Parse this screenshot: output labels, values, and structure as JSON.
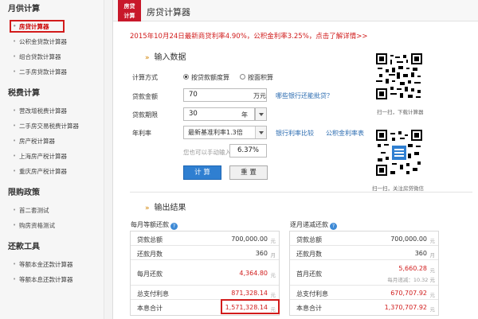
{
  "sidebar": {
    "sections": [
      {
        "title": "月供计算",
        "items": [
          "房贷计算器",
          "公积金贷款计算器",
          "组合贷款计算器",
          "二手房贷款计算器"
        ]
      },
      {
        "title": "税费计算",
        "items": [
          "营改增税费计算器",
          "二手房交易税费计算器",
          "房产税计算器",
          "上海房产税计算器",
          "重庆房产税计算器"
        ]
      },
      {
        "title": "限购政策",
        "items": [
          "首二套测试",
          "购房资格测试"
        ]
      },
      {
        "title": "还款工具",
        "items": [
          "等额本金还款计算器",
          "等额本息还款计算器"
        ]
      }
    ]
  },
  "header": {
    "badge_line1": "房贷",
    "badge_line2": "计算",
    "title": "房贷计算器"
  },
  "notice": "2015年10月24日最新商贷利率4.90%，公积金利率3.25%，点击了解详情>>",
  "input": {
    "section_title": "输入数据",
    "method_label": "计算方式",
    "method_options": [
      "按贷款额度算",
      "按面积算"
    ],
    "amount_label": "贷款金额",
    "amount_value": "70",
    "amount_unit": "万元",
    "amount_link": "哪些银行还能批贷？",
    "term_label": "贷款期限",
    "term_value": "30",
    "term_unit": "年",
    "rate_label": "年利率",
    "rate_select": "最新基准利率1.3倍",
    "rate_link1": "银行利率比较",
    "rate_link2": "公积金利率表",
    "rate_hint": "您也可以手动输入",
    "rate_value": "6.37%",
    "calc_button": "计 算",
    "reset_button": "重 置"
  },
  "qr": [
    {
      "caption": "扫一扫，下载计算器"
    },
    {
      "caption": "扫一扫，关注房贷微信"
    }
  ],
  "output": {
    "section_title": "输出结果",
    "equal_payment": {
      "title": "每月等额还款",
      "rows": [
        {
          "label": "贷款总额",
          "value": "700,000.00",
          "unit": "元"
        },
        {
          "label": "还款月数",
          "value": "360",
          "unit": "月"
        },
        {
          "label": "每月还款",
          "value": "4,364.80",
          "unit": "元"
        },
        {
          "label": "总支付利息",
          "value": "871,328.14",
          "unit": "元"
        },
        {
          "label": "本息合计",
          "value": "1,571,328.14",
          "unit": "元"
        }
      ]
    },
    "decreasing_payment": {
      "title": "逐月递减还款",
      "rows": [
        {
          "label": "贷款总额",
          "value": "700,000.00",
          "unit": "元"
        },
        {
          "label": "还款月数",
          "value": "360",
          "unit": "月"
        },
        {
          "label": "首月还款",
          "value": "5,660.28",
          "unit": "元",
          "sub": "每月递减：10.32 元"
        },
        {
          "label": "总支付利息",
          "value": "670,707.92",
          "unit": "元"
        },
        {
          "label": "本息合计",
          "value": "1,370,707.92",
          "unit": "元"
        }
      ]
    }
  },
  "colors": {
    "accent_red": "#d01b1b",
    "link_blue": "#2a6bb0",
    "button_blue": "#2f7fd1",
    "brand_red": "#c8182a"
  }
}
